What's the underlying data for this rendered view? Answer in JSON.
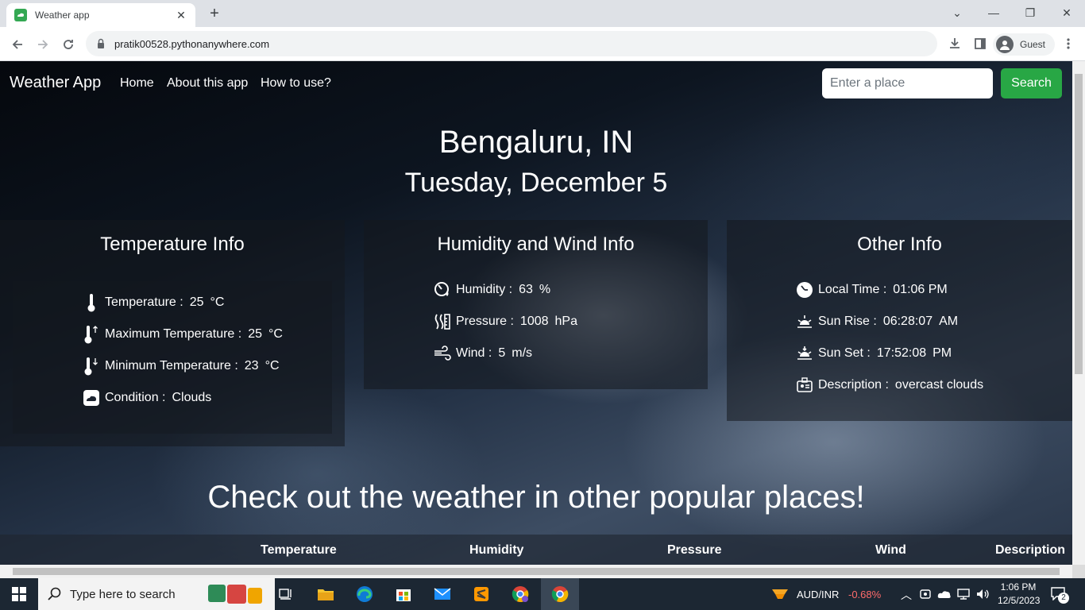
{
  "browser": {
    "tab_title": "Weather app",
    "new_tab_icon": "plus-icon",
    "url": "pratik00528.pythonanywhere.com",
    "profile_label": "Guest"
  },
  "navbar": {
    "brand": "Weather App",
    "links": [
      "Home",
      "About this app",
      "How to use?"
    ],
    "search_placeholder": "Enter a place",
    "search_button": "Search",
    "search_button_color": "#28a745"
  },
  "location": {
    "city": "Bengaluru, IN",
    "date": "Tuesday, December 5"
  },
  "temperature_info": {
    "title": "Temperature Info",
    "rows": [
      {
        "icon": "thermometer-icon",
        "label": "Temperature :",
        "value": "25",
        "unit": "°C"
      },
      {
        "icon": "thermometer-up-icon",
        "label": "Maximum Temperature :",
        "value": "25",
        "unit": "°C"
      },
      {
        "icon": "thermometer-down-icon",
        "label": "Minimum Temperature :",
        "value": "23",
        "unit": "°C"
      },
      {
        "icon": "cloud-icon",
        "label": "Condition :",
        "value": "Clouds",
        "unit": ""
      }
    ]
  },
  "humidity_wind_info": {
    "title": "Humidity and Wind Info",
    "rows": [
      {
        "icon": "humidity-icon",
        "label": "Humidity :",
        "value": "63",
        "unit": "%"
      },
      {
        "icon": "pressure-icon",
        "label": "Pressure :",
        "value": "1008",
        "unit": "hPa"
      },
      {
        "icon": "wind-icon",
        "label": "Wind :",
        "value": "5",
        "unit": "m/s"
      }
    ]
  },
  "other_info": {
    "title": "Other Info",
    "rows": [
      {
        "icon": "clock-icon",
        "label": "Local Time :",
        "value": "01:06 PM",
        "unit": ""
      },
      {
        "icon": "sunrise-icon",
        "label": "Sun Rise :",
        "value": "06:28:07",
        "unit": "AM"
      },
      {
        "icon": "sunset-icon",
        "label": "Sun Set :",
        "value": "17:52:08",
        "unit": "PM"
      },
      {
        "icon": "description-icon",
        "label": "Description :",
        "value": "overcast clouds",
        "unit": ""
      }
    ]
  },
  "popular": {
    "heading": "Check out the weather in other popular places!",
    "columns": [
      "Temperature",
      "Humidity",
      "Pressure",
      "Wind",
      "Description"
    ]
  },
  "taskbar": {
    "search_placeholder": "Type here to search",
    "currency_pair": "AUD/INR",
    "currency_change": "-0.68%",
    "currency_change_color": "#ff6b6b",
    "time": "1:06 PM",
    "date": "12/5/2023",
    "notification_count": "2"
  }
}
